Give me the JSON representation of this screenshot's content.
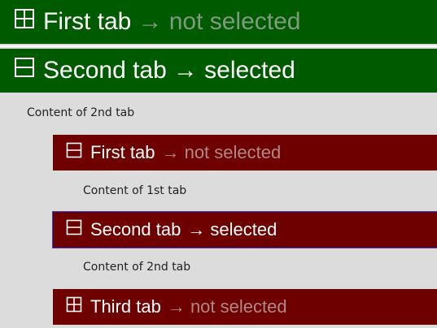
{
  "outer_tabs": {
    "tab1": {
      "icon": "grid-expand-icon",
      "label": "First tab",
      "state": "→ not selected"
    },
    "tab2": {
      "icon": "collapse-icon",
      "label": "Second tab",
      "state": "→ selected"
    }
  },
  "outer_content": "Content of 2nd tab",
  "inner_tabs": {
    "tab1": {
      "icon": "collapse-icon",
      "label": "First tab",
      "state": "→ not selected",
      "content": "Content of 1st tab"
    },
    "tab2": {
      "icon": "collapse-icon",
      "label": "Second tab",
      "state": "→ selected",
      "content": "Content of 2nd tab"
    },
    "tab3": {
      "icon": "grid-expand-icon",
      "label": "Third tab",
      "state": "→ not selected"
    }
  },
  "colors": {
    "outer_tab_bg": "#005a00",
    "inner_tab_bg": "#6e0000",
    "page_bg": "#dcdcdc",
    "focus_outline": "#3344cc"
  }
}
